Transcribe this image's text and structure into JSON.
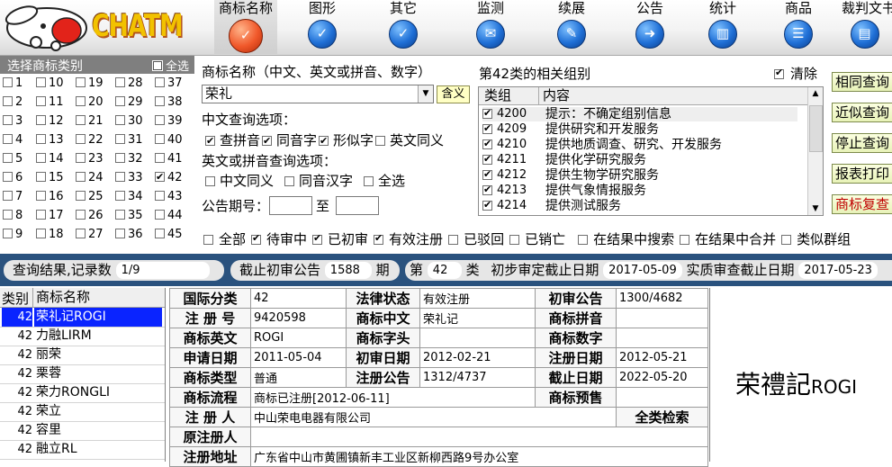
{
  "app": {
    "logo_text": "CHATM"
  },
  "nav": [
    {
      "label": "商标名称",
      "icon": "pen-icon"
    },
    {
      "label": "图形",
      "icon": "pen-icon"
    },
    {
      "label": "其它",
      "icon": "pen-icon"
    },
    {
      "label": "监测",
      "icon": "mail-icon"
    },
    {
      "label": "续展",
      "icon": "edit-icon"
    },
    {
      "label": "公告",
      "icon": "arrow-right-icon"
    },
    {
      "label": "统计",
      "icon": "chart-icon"
    },
    {
      "label": "商品",
      "icon": "list-icon"
    },
    {
      "label": "裁判文书",
      "icon": "tray-icon"
    }
  ],
  "classes": {
    "title": "选择商标类别",
    "select_all": "全选",
    "items": [
      "1",
      "2",
      "3",
      "4",
      "5",
      "6",
      "7",
      "8",
      "9",
      "10",
      "11",
      "12",
      "13",
      "14",
      "15",
      "16",
      "17",
      "18",
      "19",
      "20",
      "21",
      "22",
      "23",
      "24",
      "25",
      "26",
      "27",
      "28",
      "29",
      "30",
      "31",
      "32",
      "33",
      "34",
      "35",
      "36",
      "37",
      "38",
      "39",
      "40",
      "41",
      "42",
      "43",
      "44",
      "45"
    ],
    "checked": [
      "42"
    ]
  },
  "query": {
    "name_label": "商标名称（中文、英文或拼音、数字）",
    "name_value": "荣礼",
    "hanyi_button": "含义",
    "cn_options_label": "中文查询选项：",
    "cn_options": [
      {
        "label": "查拼音",
        "checked": true
      },
      {
        "label": "同音字",
        "checked": true
      },
      {
        "label": "形似字",
        "checked": true
      },
      {
        "label": "英文同义",
        "checked": false
      }
    ],
    "en_options_label": "英文或拼音查询选项：",
    "en_options": [
      {
        "label": "中文同义",
        "checked": false
      },
      {
        "label": "同音汉字",
        "checked": false
      },
      {
        "label": "全选",
        "checked": false
      }
    ],
    "issue_label": "公告期号：",
    "issue_to": "至"
  },
  "groups": {
    "title": "第42类的相关组别",
    "clear_label": "清除",
    "col_group": "类组",
    "col_content": "内容",
    "rows": [
      {
        "code": "4200",
        "text": "提示：不确定组别信息"
      },
      {
        "code": "4209",
        "text": "提供研究和开发服务"
      },
      {
        "code": "4210",
        "text": "提供地质调查、研究、开发服务"
      },
      {
        "code": "4211",
        "text": "提供化学研究服务"
      },
      {
        "code": "4212",
        "text": "提供生物学研究服务"
      },
      {
        "code": "4213",
        "text": "提供气象情报服务"
      },
      {
        "code": "4214",
        "text": "提供测试服务"
      }
    ]
  },
  "actions": [
    "相同查询",
    "近似查询",
    "停止查询",
    "报表打印",
    "商标复查"
  ],
  "filters": [
    {
      "label": "全部",
      "checked": false
    },
    {
      "label": "待审中",
      "checked": true
    },
    {
      "label": "已初审",
      "checked": true
    },
    {
      "label": "有效注册",
      "checked": true
    },
    {
      "label": "已驳回",
      "checked": false
    },
    {
      "label": "已销亡",
      "checked": false
    },
    {
      "label": "在结果中搜索",
      "checked": false
    },
    {
      "label": "在结果中合并",
      "checked": false
    },
    {
      "label": "类似群组",
      "checked": false
    }
  ],
  "status": {
    "result_label": "查询结果,记录数",
    "result_count": "1/9",
    "deadline_label": "截止初审公告",
    "deadline_issue": "1588",
    "deadline_suffix": "期",
    "class_prefix": "第",
    "class_num": "42",
    "class_suffix": "类",
    "prelim_label": "初步审定截止日期",
    "prelim_date": "2017-05-09",
    "subst_label": "实质审查截止日期",
    "subst_date": "2017-05-23"
  },
  "results": {
    "col_class": "类别",
    "col_name": "商标名称",
    "rows": [
      {
        "cls": "42",
        "name": "荣礼记ROGI"
      },
      {
        "cls": "42",
        "name": "力融LIRM"
      },
      {
        "cls": "42",
        "name": "丽荣"
      },
      {
        "cls": "42",
        "name": "栗蓉"
      },
      {
        "cls": "42",
        "name": "荣力RONGLI"
      },
      {
        "cls": "42",
        "name": "荣立"
      },
      {
        "cls": "42",
        "name": "容里"
      },
      {
        "cls": "42",
        "name": "融立RL"
      }
    ]
  },
  "detail": {
    "intl_class_k": "国际分类",
    "intl_class": "42",
    "legal_k": "法律状态",
    "legal": "有效注册",
    "prelim_k": "初审公告",
    "prelim": "1300/4682",
    "regno_k": "注 册 号",
    "regno": "9420598",
    "cn_k": "商标中文",
    "cn": "荣礼记",
    "py_k": "商标拼音",
    "py": "",
    "en_k": "商标英文",
    "en": "ROGI",
    "head_k": "商标字头",
    "head": "",
    "num_k": "商标数字",
    "num": "",
    "apply_k": "申请日期",
    "apply": "2011-05-04",
    "prelim_date_k": "初审日期",
    "prelim_date": "2012-02-21",
    "reg_date_k": "注册日期",
    "reg_date": "2012-05-21",
    "type_k": "商标类型",
    "type": "普通",
    "reg_ann_k": "注册公告",
    "reg_ann": "1312/4737",
    "expiry_k": "截止日期",
    "expiry": "2022-05-20",
    "flow_k": "商标流程",
    "flow": "商标已注册[2012-06-11]",
    "warn_k": "商标预售",
    "warn": "",
    "reg_person_k": "注 册 人",
    "reg_person": "中山荣电电器有限公司",
    "all_search": "全类检索",
    "orig_person_k": "原注册人",
    "orig_person": "",
    "addr_k": "注册地址",
    "addr": "广东省中山市黄圃镇新丰工业区新柳西路9号办公室"
  },
  "mark": {
    "cn": "荣禮記",
    "en": "ROGI"
  }
}
